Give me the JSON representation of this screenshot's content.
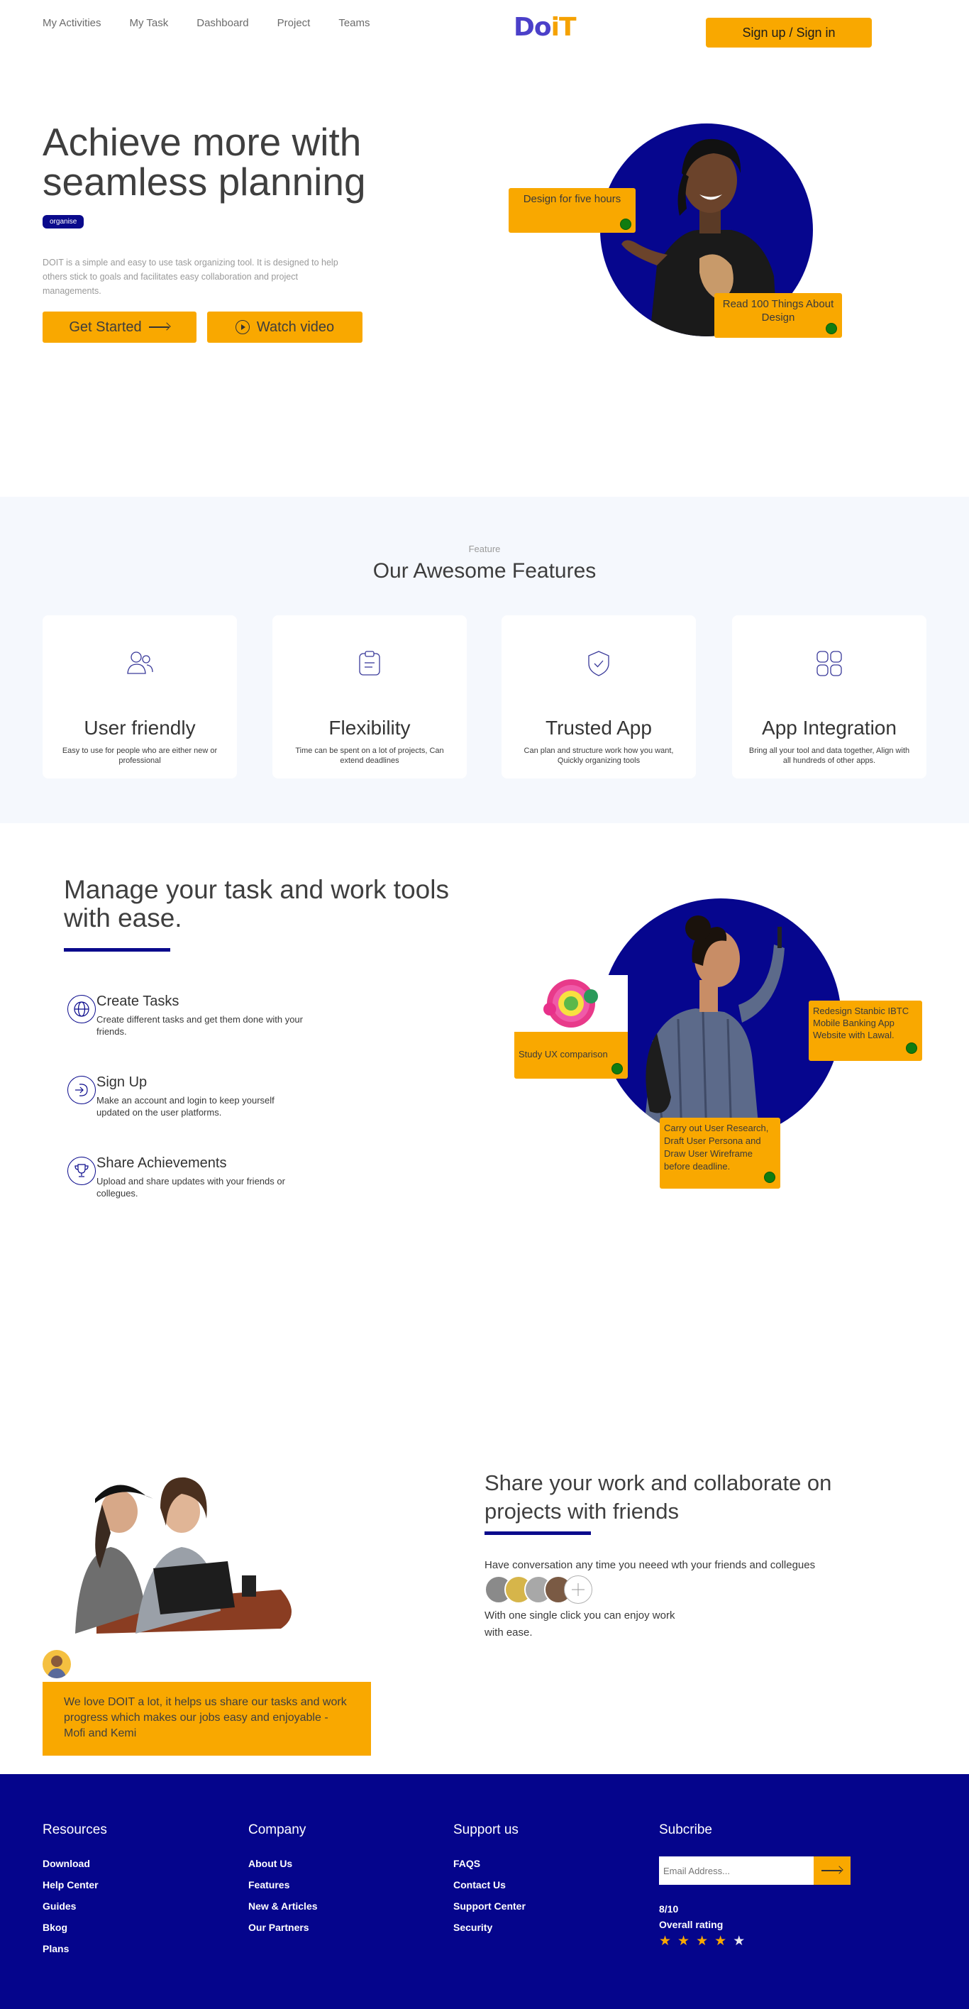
{
  "nav": {
    "links": [
      "My Activities",
      "My Task",
      "Dashboard",
      "Project",
      "Teams"
    ],
    "logo_part1": "Do",
    "logo_part2": "iT",
    "signup_label": "Sign up / Sign in"
  },
  "hero": {
    "title": "Achieve more with seamless planning",
    "tag": "organise",
    "description": "DOIT is a simple and easy to use task organizing tool. It is designed to help others stick to goals and facilitates easy collaboration and project managements.",
    "get_started": "Get Started",
    "watch_video": "Watch video",
    "card1": "Design for five hours",
    "card2": "Read 100 Things About Design"
  },
  "features": {
    "kicker": "Feature",
    "title": "Our Awesome Features",
    "cards": [
      {
        "title": "User friendly",
        "desc": "Easy to use for people who are either new or professional",
        "icon": "users-icon"
      },
      {
        "title": "Flexibility",
        "desc": "Time can be spent on a lot of projects, Can extend deadlines",
        "icon": "clipboard-icon"
      },
      {
        "title": "Trusted App",
        "desc": "Can plan and structure work how you want, Quickly organizing tools",
        "icon": "shield-check-icon"
      },
      {
        "title": "App Integration",
        "desc": "Bring all your tool and data together, Align with all hundreds of other apps.",
        "icon": "grid-apps-icon"
      }
    ]
  },
  "manage": {
    "title": "Manage your task and work tools with ease.",
    "items": [
      {
        "title": "Create Tasks",
        "desc": "Create different tasks and get them done with your friends.",
        "icon": "globe-icon"
      },
      {
        "title": "Sign Up",
        "desc": "Make an account and login to keep yourself updated on the user platforms.",
        "icon": "login-icon"
      },
      {
        "title": "Share Achievements",
        "desc": "Upload and share updates with your friends or collegues.",
        "icon": "trophy-icon"
      }
    ],
    "card_study": "Study UX comparison",
    "card_redesign": "Redesign Stanbic IBTC Mobile Banking App Website with Lawal.",
    "card_research": "Carry out User Research, Draft User Persona and Draw User Wireframe before deadline."
  },
  "share": {
    "title": "Share your work and collaborate on projects with friends",
    "line1": "Have conversation any time you neeed wth your friends and collegues",
    "line2": "With one single click you can enjoy work with ease.",
    "testimonial": "We love DOIT a lot, it helps us share our tasks and work progress which makes our jobs easy and enjoyable - Mofi and Kemi"
  },
  "footer": {
    "resources": {
      "title": "Resources",
      "links": [
        "Download",
        "Help Center",
        "Guides",
        "Bkog",
        "Plans"
      ]
    },
    "company": {
      "title": "Company",
      "links": [
        "About Us",
        "Features",
        "New & Articles",
        "Our Partners"
      ]
    },
    "support": {
      "title": "Support us",
      "links": [
        "FAQS",
        "Contact Us",
        "Support Center",
        "Security"
      ]
    },
    "subscribe": {
      "title": "Subcribe",
      "placeholder": "Email Address...",
      "rating_value": "8/10",
      "rating_label": "Overall rating",
      "stars_filled": 4,
      "stars_total": 5
    }
  },
  "colors": {
    "brand_navy": "#05058c",
    "accent_orange": "#f9a800",
    "status_green": "#107c10"
  }
}
